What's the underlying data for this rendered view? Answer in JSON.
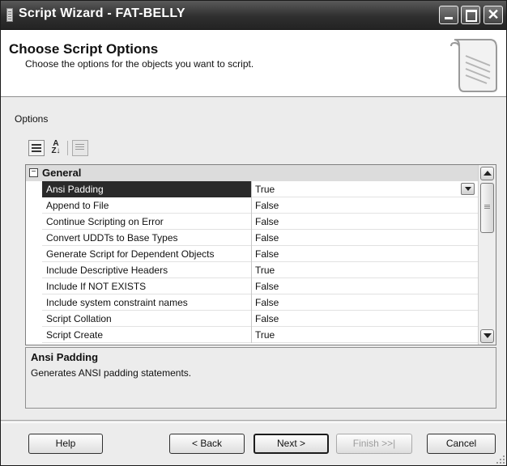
{
  "window": {
    "title": "Script Wizard - FAT-BELLY"
  },
  "header": {
    "title": "Choose Script Options",
    "subtitle": "Choose the options for the objects you want to script."
  },
  "options_label": "Options",
  "toolbar": {
    "categorized_icon": "categorized-icon",
    "sort_icon": "alphabetical-sort-icon",
    "pages_icon": "property-pages-icon"
  },
  "grid": {
    "category": {
      "toggle": "⊟",
      "label": "General"
    },
    "rows": [
      {
        "name": "Ansi Padding",
        "value": "True",
        "selected": true
      },
      {
        "name": "Append to File",
        "value": "False"
      },
      {
        "name": "Continue Scripting on Error",
        "value": "False"
      },
      {
        "name": "Convert UDDTs to Base Types",
        "value": "False"
      },
      {
        "name": "Generate Script for Dependent Objects",
        "value": "False"
      },
      {
        "name": "Include Descriptive Headers",
        "value": "True"
      },
      {
        "name": "Include If NOT EXISTS",
        "value": "False"
      },
      {
        "name": "Include system constraint names",
        "value": "False"
      },
      {
        "name": "Script Collation",
        "value": "False"
      },
      {
        "name": "Script Create",
        "value": "True"
      }
    ]
  },
  "description": {
    "title": "Ansi Padding",
    "text": "Generates ANSI padding statements."
  },
  "buttons": {
    "help": "Help",
    "back": "< Back",
    "next": "Next >",
    "finish": "Finish >>|",
    "cancel": "Cancel"
  },
  "colors": {
    "titlebar": "#2f2f2f",
    "selected_row": "#2a2a2a",
    "category_bg": "#dcdcdc",
    "dialog_bg": "#ececec"
  }
}
